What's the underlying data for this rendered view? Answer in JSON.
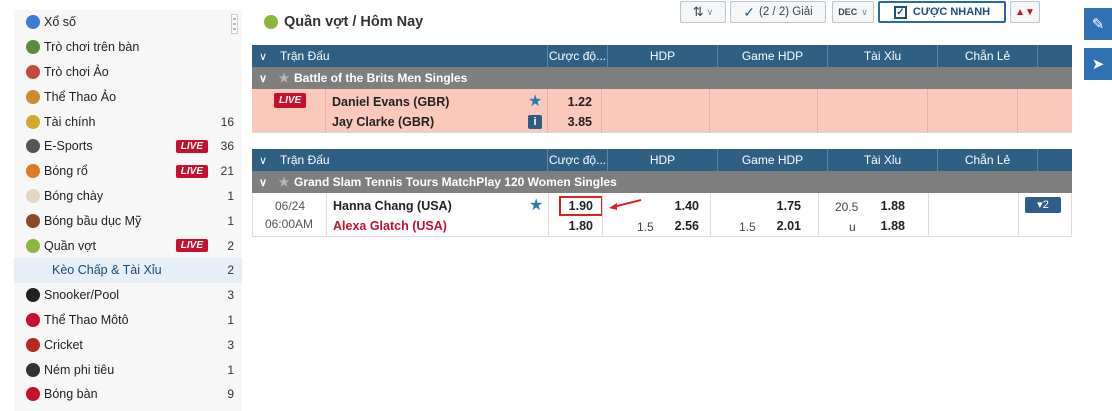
{
  "sidebar": {
    "items": [
      {
        "label": "Xổ số",
        "icon": "lottery-icon",
        "color": "#3a7bd5"
      },
      {
        "label": "Trò chơi trên bàn",
        "icon": "table-game-icon",
        "color": "#5b8c3a"
      },
      {
        "label": "Trò chơi Ảo",
        "icon": "virtual-game-icon",
        "color": "#c44b3c"
      },
      {
        "label": "Thể Thao Ảo",
        "icon": "virtual-sports-icon",
        "color": "#d08c2c"
      },
      {
        "label": "Tài chính",
        "icon": "finance-icon",
        "color": "#d4a82a",
        "count": "16"
      },
      {
        "label": "E-Sports",
        "icon": "esports-icon",
        "color": "#555555",
        "count": "36",
        "live": "LIVE"
      },
      {
        "label": "Bóng rổ",
        "icon": "basketball-icon",
        "color": "#e07b22",
        "count": "21",
        "live": "LIVE"
      },
      {
        "label": "Bóng chày",
        "icon": "baseball-icon",
        "color": "#e2d7c3",
        "count": "1"
      },
      {
        "label": "Bóng bầu dục Mỹ",
        "icon": "football-icon",
        "color": "#8a4b22",
        "count": "1"
      },
      {
        "label": "Quần vợt",
        "icon": "tennis-icon",
        "color": "#8cb73a",
        "count": "2",
        "live": "LIVE"
      },
      {
        "label": "Kèo Chấp & Tài Xỉu",
        "sub": true,
        "count": "2"
      },
      {
        "label": "Snooker/Pool",
        "icon": "snooker-icon",
        "color": "#222222",
        "count": "3"
      },
      {
        "label": "Thể Thao Môtô",
        "icon": "motorsport-icon",
        "color": "#c8102e",
        "count": "1"
      },
      {
        "label": "Cricket",
        "icon": "cricket-icon",
        "color": "#b7281e",
        "count": "3"
      },
      {
        "label": "Ném phi tiêu",
        "icon": "darts-icon",
        "color": "#333333",
        "count": "1"
      },
      {
        "label": "Bóng bàn",
        "icon": "table-tennis-icon",
        "color": "#c8102e",
        "count": "9"
      }
    ]
  },
  "header": {
    "title": "Quần vợt / Hôm Nay",
    "filter_label": "(2 / 2) Giải",
    "odds_format": "DEC",
    "quick_bet": "CƯỢC NHANH"
  },
  "table1": {
    "columns": [
      "Trận Đấu",
      "Cược độ...",
      "HDP",
      "Game HDP",
      "Tài Xỉu",
      "Chẵn Lẻ"
    ],
    "league": "Battle of the Brits Men Singles",
    "match": {
      "live": "LIVE",
      "home": "Daniel Evans (GBR)",
      "away": "Jay Clarke (GBR)",
      "odds_home": "1.22",
      "odds_away": "3.85"
    }
  },
  "table2": {
    "columns": [
      "Trận Đấu",
      "Cược độ...",
      "HDP",
      "Game HDP",
      "Tài Xỉu",
      "Chẵn Lẻ"
    ],
    "league": "Grand Slam Tennis Tours MatchPlay 120 Women Singles",
    "match": {
      "date": "06/24",
      "time": "06:00AM",
      "home": "Hanna Chang (USA)",
      "away": "Alexa Glatch (USA)",
      "odds_home": "1.90",
      "odds_away": "1.80",
      "hdp_line": "1.5",
      "hdp_home": "1.40",
      "hdp_away": "2.56",
      "game_line": "1.5",
      "game_home": "1.75",
      "game_away": "2.01",
      "ou_line": "20.5",
      "ou_u": "u",
      "ou_over": "1.88",
      "ou_under": "1.88",
      "more": "▾2"
    }
  },
  "colors": {
    "header_bar": "#2f5f83",
    "league_bar": "#7f7f7f",
    "live_row": "#fbc9bc",
    "live_badge": "#c8102e",
    "accent": "#2f72b3"
  }
}
